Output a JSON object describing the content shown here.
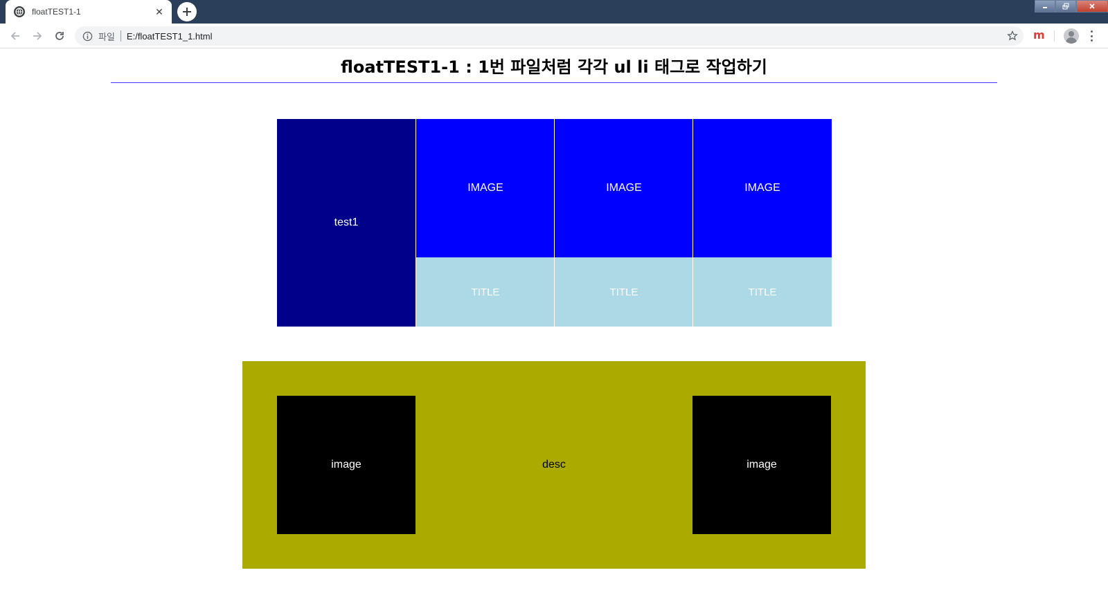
{
  "browser": {
    "tab_title": "floatTEST1-1",
    "scheme_label": "파일",
    "url": "E:/floatTEST1_1.html",
    "extension_label": "m"
  },
  "page": {
    "heading": "floatTEST1-1 : 1번 파일처럼 각각 ul li 태그로 작업하기",
    "section1": {
      "left_label": "test1",
      "cards": [
        {
          "image": "IMAGE",
          "title": "TITLE"
        },
        {
          "image": "IMAGE",
          "title": "TITLE"
        },
        {
          "image": "IMAGE",
          "title": "TITLE"
        }
      ]
    },
    "section2": {
      "left_image": "image",
      "desc": "desc",
      "right_image": "image"
    }
  },
  "colors": {
    "chrome_dark": "#2b3e5a",
    "heading_rule": "#4433ff",
    "navy": "#00008b",
    "blue": "#0000ff",
    "lightblue": "#add8e6",
    "olive": "#aaaa00",
    "black": "#000000"
  }
}
